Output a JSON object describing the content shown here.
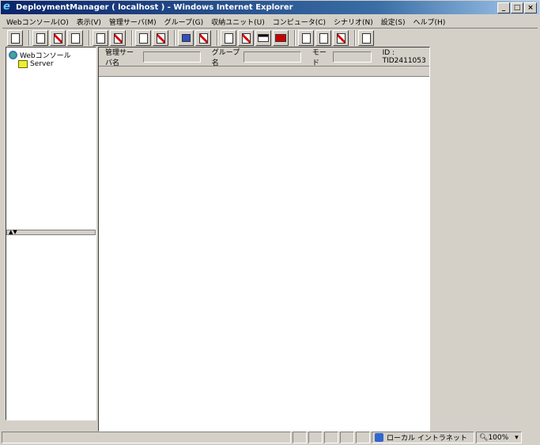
{
  "window": {
    "title": "DeploymentManager ( localhost ) - Windows Internet Explorer",
    "controls": [
      "minimize",
      "maximize",
      "close"
    ]
  },
  "menu": [
    "Webコンソール(O)",
    "表示(V)",
    "管理サーバ(M)",
    "グループ(G)",
    "収納ユニット(U)",
    "コンピュータ(C)",
    "シナリオ(N)",
    "設定(S)",
    "ヘルプ(H)"
  ],
  "toolbar": {
    "groups": [
      [
        "refresh-icon"
      ],
      [
        "computer-icon",
        "delete-computer-icon",
        "add-computer-icon"
      ],
      [
        "server-icon",
        "delete-server-icon"
      ],
      [
        "unit-icon",
        "delete-unit-icon"
      ],
      [
        "pc-icon",
        "delete-pc-icon"
      ],
      [
        "move-icon",
        "move-delete-icon",
        "window-icon",
        "stop-icon"
      ],
      [
        "document-icon",
        "edit-document-icon",
        "delete-document-icon"
      ],
      [
        "tool-icon"
      ]
    ]
  },
  "tree": {
    "root": "Webコンソール",
    "children": [
      "Server"
    ]
  },
  "info": {
    "server_label": "管理サーバ名",
    "server_value": "",
    "group_label": "グループ名",
    "group_value": "",
    "mode_label": "モード",
    "mode_value": "",
    "id_text": "ID : TID2411053"
  },
  "statusbar": {
    "text": "",
    "zone": "ローカル イントラネット",
    "zoom": "100%"
  }
}
